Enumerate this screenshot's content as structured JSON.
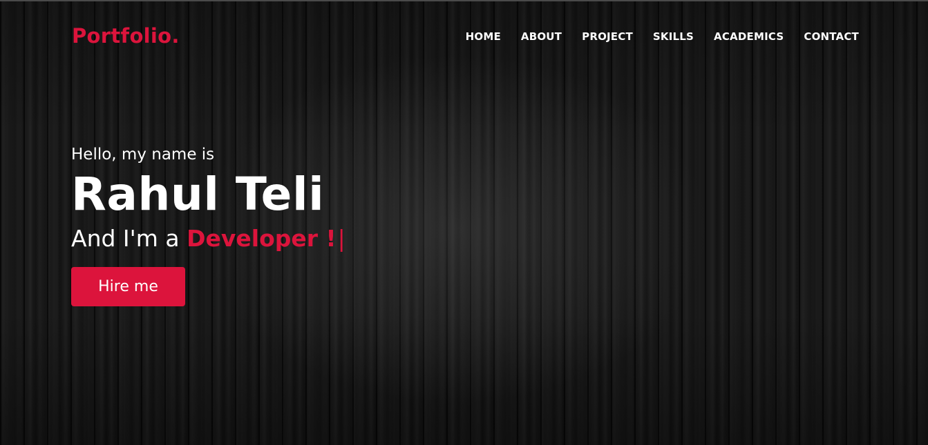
{
  "navbar": {
    "logo": "Portfolio.",
    "items": [
      {
        "label": "HOME"
      },
      {
        "label": "ABOUT"
      },
      {
        "label": "PROJECT"
      },
      {
        "label": "SKILLS"
      },
      {
        "label": "ACADEMICS"
      },
      {
        "label": "CONTACT"
      }
    ]
  },
  "hero": {
    "greeting": "Hello, my name is",
    "name": "Rahul Teli",
    "tagline_prefix": "And I'm a ",
    "role": "Developer !",
    "cursor": "|",
    "cta_label": "Hire me"
  },
  "colors": {
    "accent": "#dc143c",
    "text": "#ffffff",
    "background": "#141414"
  }
}
